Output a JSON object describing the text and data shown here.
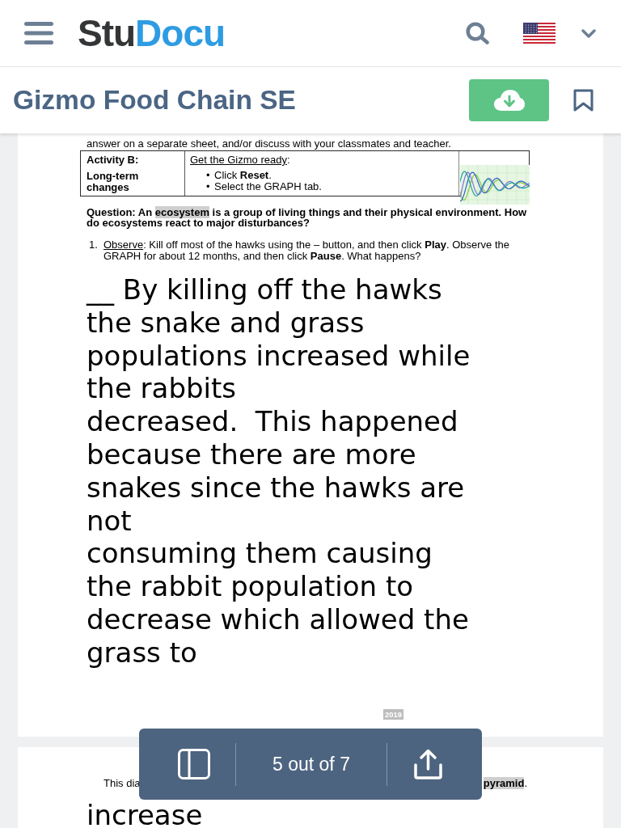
{
  "header": {
    "logo": {
      "text_dark": "Stu",
      "text_blue": "Docu"
    }
  },
  "title_bar": {
    "title": "Gizmo Food Chain SE"
  },
  "document": {
    "page_1": {
      "intro_line": "answer on a separate sheet, and/or discuss with your classmates and teacher.",
      "activity_table": {
        "title": "Activity B:",
        "subtitle": "Long-term changes",
        "heading": [
          {
            "kind": "underline",
            "text": "Get the Gizmo ready"
          },
          {
            "kind": "plain",
            "text": ":"
          }
        ],
        "steps": [
          {
            "marker": "•",
            "text": "Click **Reset**."
          },
          {
            "marker": "•",
            "text": "Select the GRAPH tab."
          }
        ]
      },
      "question": [
        {
          "kind": "plain",
          "text": "Question: An "
        },
        {
          "kind": "highlight",
          "text": "ecosystem"
        },
        {
          "kind": "plain",
          "text": " is a group of living things and their physical environment. How do ecosystems react to major disturbances?"
        }
      ],
      "items": [
        {
          "number": "1.",
          "parts": [
            {
              "kind": "underline",
              "text": "Observe"
            },
            {
              "kind": "plain",
              "text": ": Kill off most of the hawks using the – button, and then click **Play**. Observe the GRAPH for about 12 months, and then click **Pause**. What happens?"
            }
          ]
        }
      ],
      "answer_lines": [
        "__ By killing off the hawks",
        "the snake and grass",
        "populations increased while",
        "the rabbits",
        "decreased.  This happened",
        "because there are more",
        "snakes since the hawks are",
        "not",
        "consuming them causing",
        "the rabbit population to",
        "decrease which allowed the",
        "grass to"
      ],
      "footer_label": "2019"
    },
    "page_2": {
      "text_left": [
        {
          "kind": "plain",
          "text": "This dia"
        }
      ],
      "text_right": [
        {
          "kind": "highlight_bold",
          "text": "pyramid"
        },
        {
          "kind": "plain",
          "text": "."
        }
      ],
      "answer_lines": [
        "increase"
      ]
    }
  },
  "page_toolbar": {
    "page_indicator": "5 out of 7"
  }
}
